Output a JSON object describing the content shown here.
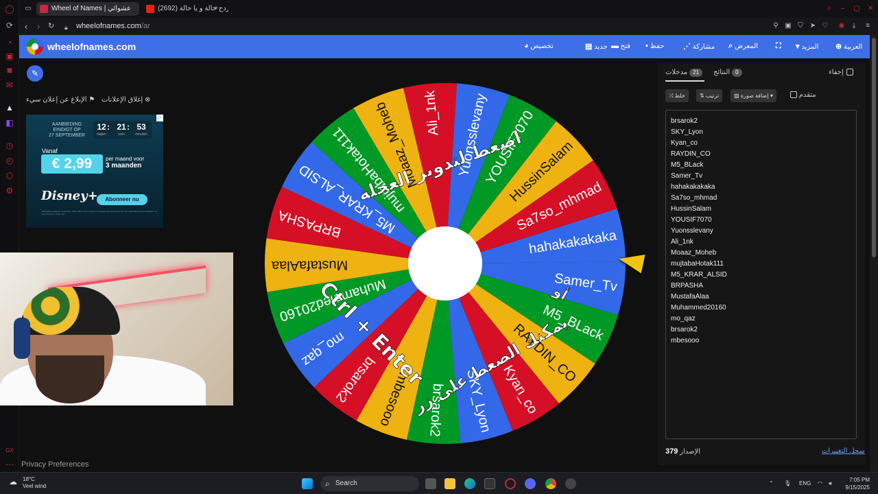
{
  "browser": {
    "tabs": [
      {
        "title": "Wheel of Names | عشوائي",
        "active": true
      },
      {
        "title": "(2692) ردح خالة و يا خالة",
        "active": false
      }
    ],
    "url_host": "wheelofnames.com",
    "url_path": "/ar"
  },
  "header": {
    "brand": "wheelofnames.com",
    "items": [
      "تخصيص",
      "جديد",
      "فتح",
      "حفظ",
      "مشاركة",
      "المعرض",
      "المزيد",
      "العربية"
    ]
  },
  "ad_controls": {
    "close_ads": "إغلاق الإعلانات",
    "report_ad": "الإبلاغ عن إعلان سيء"
  },
  "ad": {
    "line1": "AANBIEDING",
    "line2": "EINDIGT OP",
    "line3": "27 SEPTEMBER",
    "hours": "12",
    "minutes": "21",
    "seconds": "53",
    "hours_label": "dagen",
    "minutes_label": "uren",
    "seconds_label": "minuten",
    "vanaf": "Vanaf",
    "price": "€ 2,99",
    "per_month": "per maand voor",
    "months": "3 maanden",
    "brand": "Disney+",
    "cta": "Abonneer nu",
    "fineprint": "Aanbieding eindigt 27 september 2025. Alleen voor nieuwe en terugkerende abonnees die hun maandabonnement afsluiten. Je moet 18 jaar of ouder zijn."
  },
  "wheel": {
    "overlay_top": "اضغط لتدوير العجلة",
    "overlay_or": "أو",
    "overlay_bottom": "يمكنك الضغط على زر",
    "shortcut": "Ctrl + Enter",
    "colors": [
      "#3369e8",
      "#d50f25",
      "#eeb211",
      "#009925"
    ],
    "slices": [
      "hahakakakaka",
      "Sa7so_mhmad",
      "HussinSalam",
      "YOUSIF7070",
      "Yuonsslevany",
      "Ali_1nk",
      "Moaaz_Moheb",
      "mujtabaHotak111",
      "M5_KRAR_ALSID",
      "BRPASHA",
      "MustafaAlaa",
      "Muhammed20160",
      "mo_qaz",
      "brsarok2",
      "mbesooo",
      "brsarok2",
      "SKY_Lyon",
      "Kyan_co",
      "RAYDIN_CO",
      "M5_BLack",
      "Samer_Tv"
    ]
  },
  "panel": {
    "tab_entries_label": "مدخلات",
    "tab_entries_count": "21",
    "tab_results_label": "النتائج",
    "tab_results_count": "0",
    "hide_label": "إخفاء",
    "shuffle_label": "خلط",
    "sort_label": "ترتيب",
    "add_image_label": "إضافة صورة",
    "advanced_label": "متقدم",
    "entries": [
      "brsarok2",
      "SKY_Lyon",
      "Kyan_co",
      "RAYDIN_CO",
      "M5_BLack",
      "Samer_Tv",
      "hahakakakaka",
      "Sa7so_mhmad",
      "HussinSalam",
      "YOUSIF7070",
      "Yuonsslevany",
      "Ali_1nk",
      "Moaaz_Moheb",
      "mujtabaHotak111",
      "M5_KRAR_ALSID",
      "BRPASHA",
      "MustafaAlaa",
      "Muhammed20160",
      "mo_qaz",
      "brsarok2",
      "mbesooo"
    ],
    "version_label": "الإصدار",
    "version": "379",
    "changelog": "سجل التغييرات"
  },
  "privacy": "Privacy Preferences",
  "taskbar": {
    "temp": "18°C",
    "weather": "Veel wind",
    "search": "Search",
    "lang": "ENG",
    "time": "7:05 PM",
    "date": "9/15/2025"
  }
}
